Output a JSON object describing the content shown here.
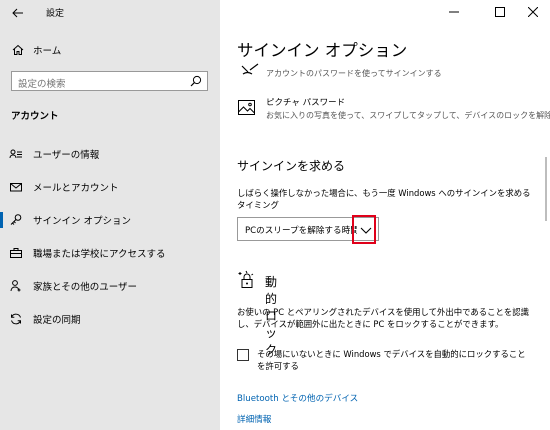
{
  "window": {
    "app_title": "設定",
    "controls": {
      "minimize": "—",
      "maximize": "☐",
      "close": "✕"
    }
  },
  "sidebar": {
    "home_label": "ホーム",
    "search_placeholder": "設定の検索",
    "section_heading": "アカウント",
    "items": [
      {
        "label": "ユーザーの情報",
        "icon": "user-info-icon"
      },
      {
        "label": "メールとアカウント",
        "icon": "mail-icon"
      },
      {
        "label": "サインイン オプション",
        "icon": "key-icon",
        "active": true
      },
      {
        "label": "職場または学校にアクセスする",
        "icon": "briefcase-icon"
      },
      {
        "label": "家族とその他のユーザー",
        "icon": "people-icon"
      },
      {
        "label": "設定の同期",
        "icon": "sync-icon"
      }
    ]
  },
  "main": {
    "title": "サインイン オプション",
    "password_row_text": "アカウントのパスワードを使ってサインインする",
    "picture_password": {
      "title": "ピクチャ パスワード",
      "description": "お気に入りの写真を使って、スワイプしてタップして、デバイスのロックを解除する"
    },
    "require_signin": {
      "heading": "サインインを求める",
      "description": "しばらく操作しなかった場合に、もう一度 Windows へのサインインを求めるタイミング",
      "dropdown_value": "PCのスリープを解除する時間"
    },
    "dynamic_lock": {
      "heading": "動的ロック",
      "description": "お使いの PC とペアリングされたデバイスを使用して外出中であることを認識し、デバイスが範囲外に出たときに PC をロックすることができます。",
      "checkbox_label": "その場にいないときに Windows でデバイスを自動的にロックすることを許可する"
    },
    "links": {
      "bluetooth": "Bluetooth とその他のデバイス",
      "details": "詳細情報"
    }
  },
  "colors": {
    "accent": "#0063b1",
    "highlight": "#e0001a",
    "sidebar_bg": "#e6e6e6"
  }
}
